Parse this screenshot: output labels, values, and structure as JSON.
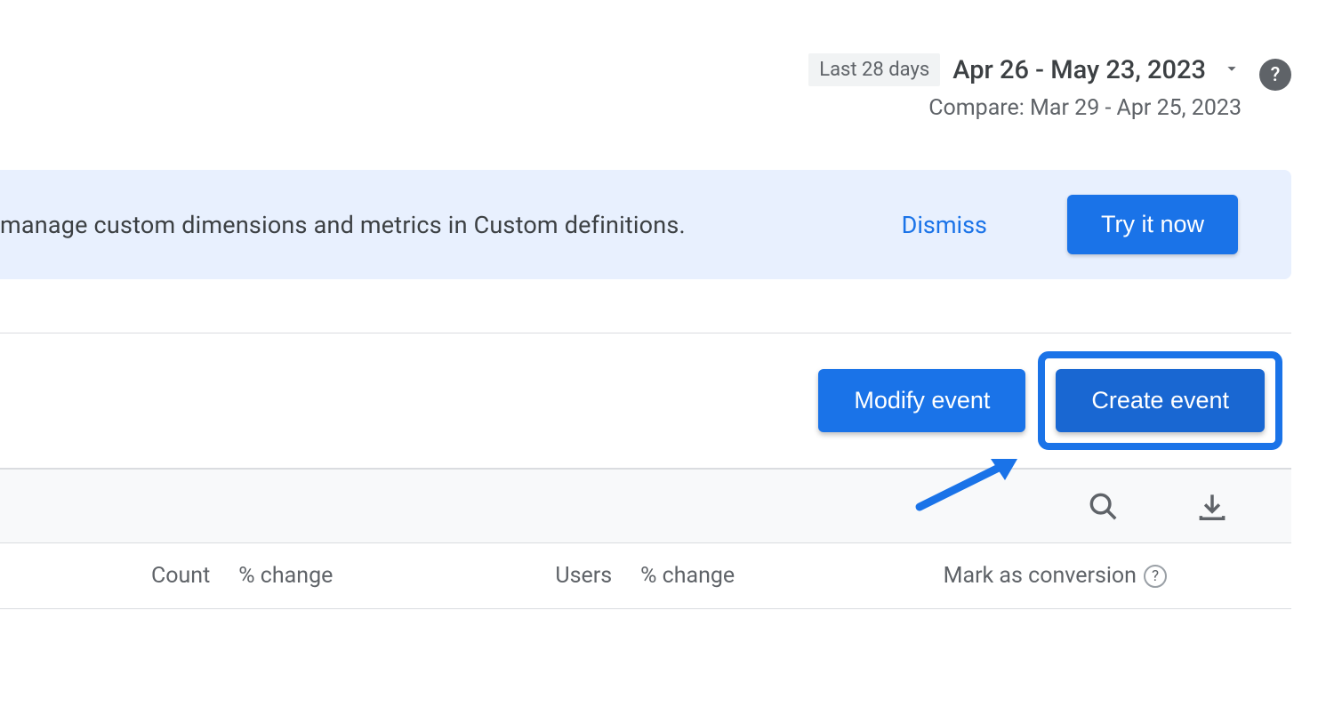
{
  "header": {
    "badge": "Last 28 days",
    "date_range": "Apr 26 - May 23, 2023",
    "compare": "Compare: Mar 29 - Apr 25, 2023"
  },
  "banner": {
    "text": "manage custom dimensions and metrics in Custom definitions.",
    "dismiss": "Dismiss",
    "try": "Try it now"
  },
  "events": {
    "modify": "Modify event",
    "create": "Create event"
  },
  "columns": {
    "count": "Count",
    "pct_change1": "% change",
    "users": "Users",
    "pct_change2": "% change",
    "mark": "Mark as conversion"
  }
}
